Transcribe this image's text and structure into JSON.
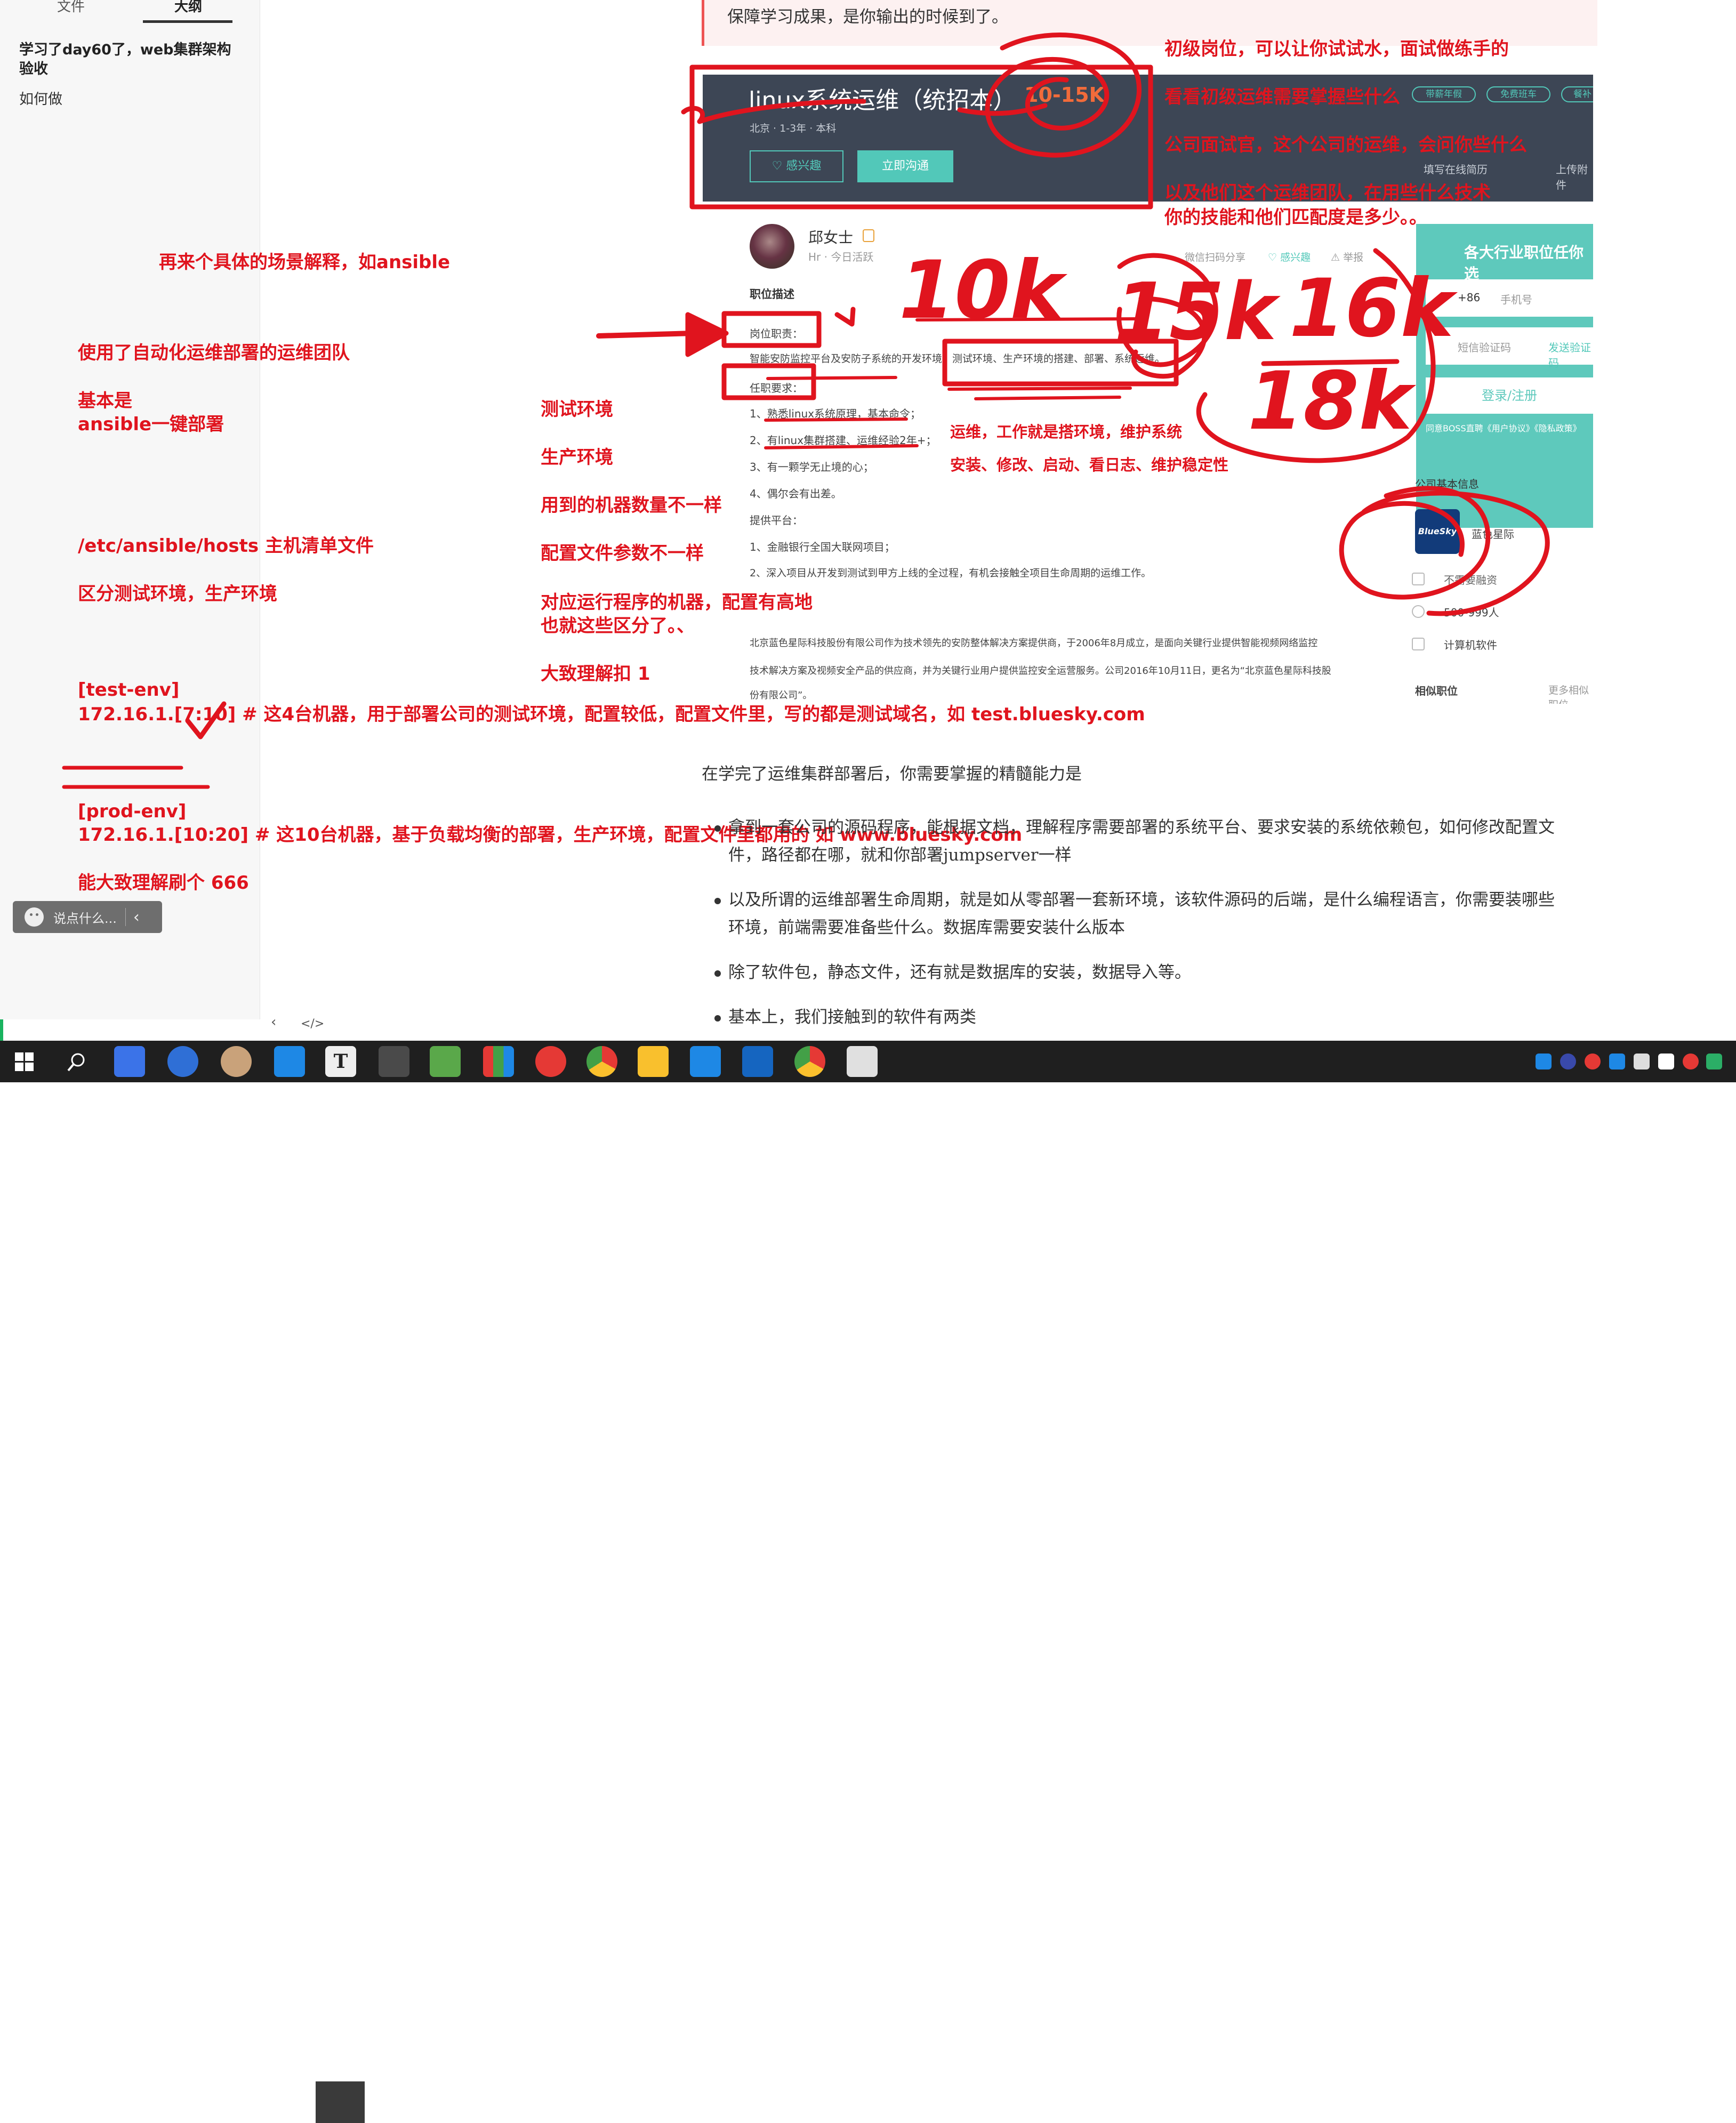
{
  "sidebar": {
    "tabs": [
      "文件",
      "大纲"
    ],
    "outline_title": "学习了day60了，web集群架构验收",
    "outline_sub": "如何做",
    "chat_placeholder": "说点什么..."
  },
  "bottom_nav": {
    "prev": "‹",
    "code": "</>"
  },
  "doc_top_line": "保障学习成果，是你输出的时候到了。",
  "job": {
    "title": "linux系统运维（统招本）",
    "salary": "10-15K",
    "meta": "北京 · 1-3年 · 本科",
    "btn_interest": "♡ 感兴趣",
    "btn_chat": "立即沟通",
    "pills": [
      "带薪年假",
      "免费班车",
      "餐补"
    ],
    "fill_resume": "填写在线简历",
    "upload": "上传附件",
    "hr_name": "邱女士",
    "hr_status": "Hr · 今日活跃",
    "actions": [
      "微信扫码分享",
      "♡ 感兴趣",
      "⚠ 举报"
    ],
    "section_title": "职位描述",
    "duty_label": "岗位职责：",
    "duty_text": "智能安防监控平台及安防子系统的开发环境、测试环境、生产环境的搭建、部署、系统运维。",
    "req_label": "任职要求：",
    "requirements": [
      "1、熟悉linux系统原理，基本命令；",
      "2、有linux集群搭建、运维经验2年+；",
      "3、有一颗学无止境的心；",
      "4、偶尔会有出差。"
    ],
    "platform_label": "提供平台：",
    "platforms": [
      "1、金融银行全国大联网项目；",
      "2、深入项目从开发到测试到甲方上线的全过程，有机会接触全项目生命周期的运维工作。"
    ],
    "company_intro": [
      "北京蓝色星际科技股份有限公司作为技术领先的安防整体解决方案提供商，于2006年8月成立，是面向关键行业提供智能视频网络监控",
      "技术解决方案及视频安全产品的供应商，并为关键行业用户提供监控安全运营服务。公司2016年10月11日，更名为“北京蓝色星际科技股",
      "份有限公司”。"
    ],
    "register": {
      "title": "各大行业职位任你选",
      "phone_prefix": "+86",
      "phone_placeholder": "手机号",
      "sms_placeholder": "短信验证码",
      "send_code": "发送验证码",
      "button": "登录/注册",
      "agree": "同意BOSS直聘《用户协议》《隐私政策》"
    },
    "company_basic": "公司基本信息",
    "company_logo_text": "BlueSky",
    "company_name": "蓝色星际",
    "financing": "不需要融资",
    "size": "500-999人",
    "industry": "计算机软件",
    "similar": "相似职位",
    "more_similar": "更多相似职位"
  },
  "handwriting": [
    "10k",
    "15k",
    "16k",
    "18k"
  ],
  "annotations": {
    "scenario": "再来个具体的场景解释，如ansible",
    "team": "使用了自动化运维部署的运维团队",
    "basic1": "基本是",
    "basic2": "ansible一键部署",
    "hosts": "/etc/ansible/hosts 主机清单文件",
    "distinguish": "区分测试环境，生产环境",
    "test_group": "[test-env]",
    "test_line": "172.16.1.[7:10]   # 这4台机器，用于部署公司的测试环境，配置较低，配置文件里，写的都是测试域名，如 test.bluesky.com",
    "prod_group": "[prod-env]",
    "prod_line": "172.16.1.[10:20]  # 这10台机器，基于负载均衡的部署，生产环境，配置文件里都用的 如  www.bluesky.com",
    "understand": "能大致理解刷个 666",
    "env_test": "测试环境",
    "env_prod": "生产环境",
    "machines": "用到的机器数量不一样",
    "config": "配置文件参数不一样",
    "high_low1": "对应运行程序的机器，配置有高地",
    "high_low2": "也就这些区分了。、",
    "rough": "大致理解扣 1",
    "junior": "初级岗位，可以让你试试水，面试做练手的",
    "look": "看看初级运维需要掌握些什么",
    "interviewer": "公司面试官，这个公司的运维，会问你些什么",
    "team_tech1": "以及他们这个运维团队，在用些什么技术",
    "team_tech2": "你的技能和他们匹配度是多少。。",
    "ops1": "运维，工作就是搭环境，维护系统",
    "ops2": "安装、修改、启动、看日志、维护稳定性"
  },
  "doc": {
    "heading": "在学完了运维集群部署后，你需要掌握的精髓能力是",
    "items": [
      [
        "拿到一套公司的源码程序，能根据文档，理解程序需要部署的系统平台、要求安装的系统依赖包，如何修改配置文",
        "件，路径都在哪，就和你部署jumpserver一样"
      ],
      [
        "以及所谓的运维部署生命周期，就是如从零部署一套新环境，该软件源码的后端，是什么编程语言，你需要装哪些",
        "环境，前端需要准备些什么。数据库需要安装什么版本"
      ],
      [
        "除了软件包，静态文件，还有就是数据库的安装，数据导入等。"
      ],
      [
        "基本上，我们接触到的软件有两类"
      ]
    ]
  },
  "taskbar": {
    "apps": [
      "windows-start",
      "search",
      "feishu",
      "check-app",
      "avatar-app",
      "blue-app",
      "typora",
      "sublime",
      "notepad",
      "colorful-app",
      "swirl-app",
      "chrome",
      "file-explorer",
      "mountain-app",
      "frame-app",
      "chrome-2",
      "image-app"
    ],
    "colors": {
      "accent": "#e0141e",
      "teal": "#52c8b9",
      "header": "#3d4655"
    }
  }
}
